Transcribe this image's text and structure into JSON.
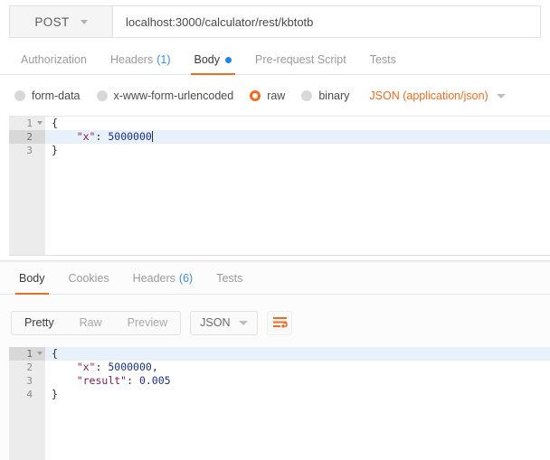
{
  "request": {
    "method": "POST",
    "method_icon": "chevron-down-icon",
    "url": "localhost:3000/calculator/rest/kbtotb",
    "tabs": [
      {
        "label": "Authorization",
        "active": false,
        "count": "",
        "dot": false
      },
      {
        "label": "Headers",
        "active": false,
        "count": "(1)",
        "dot": false
      },
      {
        "label": "Body",
        "active": true,
        "count": "",
        "dot": true
      },
      {
        "label": "Pre-request Script",
        "active": false,
        "count": "",
        "dot": false
      },
      {
        "label": "Tests",
        "active": false,
        "count": "",
        "dot": false
      }
    ],
    "body_types": [
      {
        "label": "form-data",
        "selected": false
      },
      {
        "label": "x-www-form-urlencoded",
        "selected": false
      },
      {
        "label": "raw",
        "selected": true
      },
      {
        "label": "binary",
        "selected": false
      }
    ],
    "content_type": "JSON (application/json)",
    "content_type_icon": "chevron-down-icon",
    "editor": {
      "lines": [
        {
          "num": "1",
          "fold": true,
          "active": false,
          "tokens": [
            {
              "t": "{",
              "c": "p"
            }
          ]
        },
        {
          "num": "2",
          "fold": false,
          "active": true,
          "tokens": [
            {
              "t": "    ",
              "c": "p"
            },
            {
              "t": "\"x\"",
              "c": "k"
            },
            {
              "t": ": ",
              "c": "p"
            },
            {
              "t": "5000000",
              "c": "n"
            }
          ],
          "caret": true
        },
        {
          "num": "3",
          "fold": false,
          "active": false,
          "tokens": [
            {
              "t": "}",
              "c": "p"
            }
          ]
        }
      ]
    }
  },
  "response": {
    "tabs": [
      {
        "label": "Body",
        "active": true,
        "count": "",
        "dot": false
      },
      {
        "label": "Cookies",
        "active": false,
        "count": "",
        "dot": false
      },
      {
        "label": "Headers",
        "active": false,
        "count": "(6)",
        "dot": false
      },
      {
        "label": "Tests",
        "active": false,
        "count": "",
        "dot": false
      }
    ],
    "view_modes": [
      {
        "label": "Pretty",
        "active": true
      },
      {
        "label": "Raw",
        "active": false
      },
      {
        "label": "Preview",
        "active": false
      }
    ],
    "format": "JSON",
    "format_icon": "chevron-down-icon",
    "wrap_icon": "word-wrap-icon",
    "editor": {
      "lines": [
        {
          "num": "1",
          "fold": true,
          "active": true,
          "tokens": [
            {
              "t": "{",
              "c": "p"
            }
          ]
        },
        {
          "num": "2",
          "fold": false,
          "active": false,
          "tokens": [
            {
              "t": "    ",
              "c": "p"
            },
            {
              "t": "\"x\"",
              "c": "k"
            },
            {
              "t": ": ",
              "c": "p"
            },
            {
              "t": "5000000",
              "c": "n"
            },
            {
              "t": ",",
              "c": "p"
            }
          ]
        },
        {
          "num": "3",
          "fold": false,
          "active": false,
          "tokens": [
            {
              "t": "    ",
              "c": "p"
            },
            {
              "t": "\"result\"",
              "c": "k"
            },
            {
              "t": ": ",
              "c": "p"
            },
            {
              "t": "0.005",
              "c": "n"
            }
          ]
        },
        {
          "num": "4",
          "fold": false,
          "active": false,
          "tokens": [
            {
              "t": "}",
              "c": "p"
            }
          ]
        }
      ]
    }
  },
  "colors": {
    "accent_orange": "#f06c20",
    "accent_blue": "#1b87e6",
    "link_blue": "#3f8fdf",
    "json_key": "#8b1a4a",
    "json_number": "#1b2f8f",
    "active_line": "#e8f1fb",
    "gutter": "#ececec"
  }
}
